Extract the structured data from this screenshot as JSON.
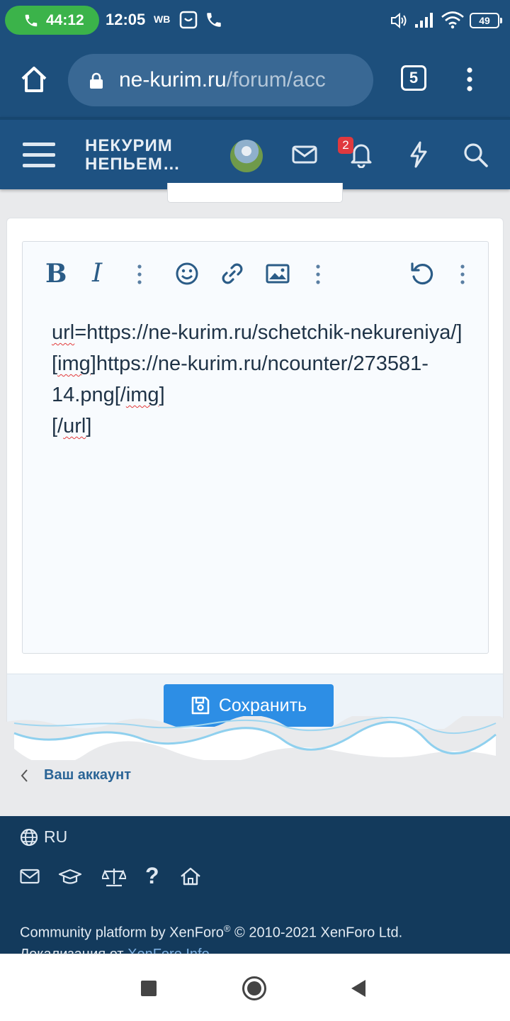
{
  "status_bar": {
    "call_timer": "44:12",
    "time": "12:05",
    "carrier_tag": "WB",
    "battery": "49",
    "icons": [
      "phone-icon",
      "shopping-bag-icon",
      "call-icon",
      "volume-icon",
      "signal-icon",
      "wifi-icon",
      "battery-icon"
    ]
  },
  "browser": {
    "url_host": "ne-kurim.ru",
    "url_path": "/forum/acc",
    "tab_count": "5"
  },
  "forum_header": {
    "logo_line1": "НЕКУРИМ",
    "logo_line2": "НЕПЬЕМ…",
    "notification_count": "2"
  },
  "editor": {
    "toolbar": [
      "bold",
      "italic",
      "more",
      "emoji",
      "link",
      "image",
      "more",
      "undo",
      "more"
    ],
    "content_parts": {
      "p1": "url",
      "p2": "=https://ne-kurim.ru/schetchik-nekureniya/][",
      "p3": "img",
      "p4": "]https://ne-kurim.ru/ncounter/273581-14.png[/",
      "p5": "img",
      "p6": "]",
      "p7": "[/",
      "p8": "url",
      "p9": "]"
    }
  },
  "save_button": {
    "label": "Сохранить"
  },
  "breadcrumb": {
    "label": "Ваш аккаунт"
  },
  "footer": {
    "language": "RU",
    "copyright_a": "Community platform by XenForo",
    "copyright_reg": "®",
    "copyright_b": " © 2010-2021 XenForo Ltd.",
    "localization_prefix": "Локализация от ",
    "localization_link": "XenForo.Info"
  },
  "colors": {
    "header_bg": "#1e5282",
    "accent": "#2d8ee5",
    "footer_bg": "#133a5c",
    "call_pill": "#3bb34a",
    "badge": "#e0393e"
  }
}
